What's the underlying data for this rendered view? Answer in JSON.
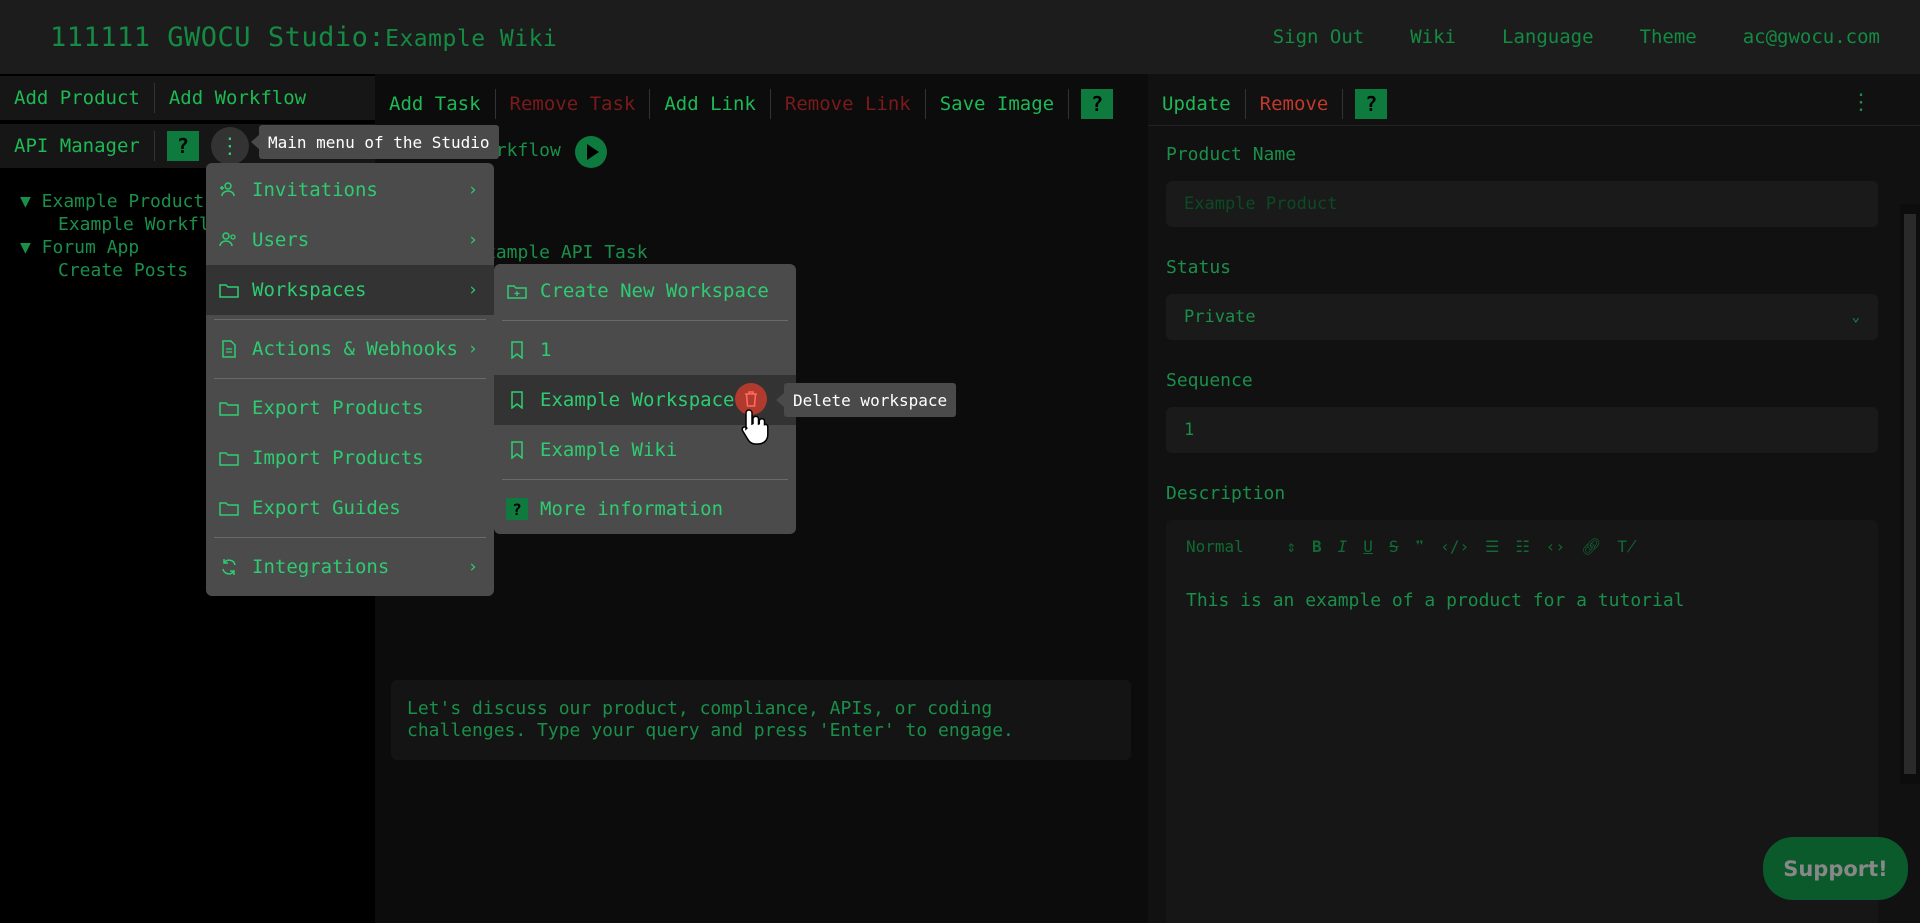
{
  "header": {
    "brand": "111111 GWOCU Studio:",
    "workspace": "Example Wiki",
    "nav": [
      "Sign Out",
      "Wiki",
      "Language",
      "Theme",
      "ac@gwocu.com"
    ]
  },
  "left": {
    "toolbar1": [
      "Add Product",
      "Add Workflow"
    ],
    "toolbar2_label": "API Manager",
    "help": "?",
    "tree": [
      {
        "label": "▼ Example Product",
        "child": "Example Workfl"
      },
      {
        "label": "▼ Forum App",
        "child": "Create Posts"
      }
    ]
  },
  "middle": {
    "toolbar": {
      "add_task": "Add Task",
      "remove_task": "Remove Task",
      "add_link": "Add Link",
      "remove_link": "Remove Link",
      "save_image": "Save Image",
      "help": "?"
    },
    "workflow_label": "orkflow",
    "task_label": "xample API Task",
    "chat_text": "Let's discuss our product, compliance, APIs, or coding challenges. Type your query and press 'Enter' to engage."
  },
  "right": {
    "toolbar": {
      "update": "Update",
      "remove": "Remove",
      "help": "?"
    },
    "product_name_label": "Product Name",
    "product_name_placeholder": "Example Product",
    "status_label": "Status",
    "status_value": "Private",
    "sequence_label": "Sequence",
    "sequence_value": "1",
    "description_label": "Description",
    "editor_format": "Normal",
    "description_text": "This is an example of a product for a tutorial"
  },
  "tooltips": {
    "main_menu": "Main menu of the Studio",
    "delete_workspace": "Delete workspace"
  },
  "main_menu": {
    "invitations": "Invitations",
    "users": "Users",
    "workspaces": "Workspaces",
    "actions": "Actions & Webhooks",
    "export_products": "Export Products",
    "import_products": "Import Products",
    "export_guides": "Export Guides",
    "integrations": "Integrations"
  },
  "workspace_menu": {
    "create": "Create New Workspace",
    "items": [
      "1",
      "Example Workspace",
      "Example Wiki"
    ],
    "more": "More information",
    "help": "?"
  },
  "support": "Support!"
}
